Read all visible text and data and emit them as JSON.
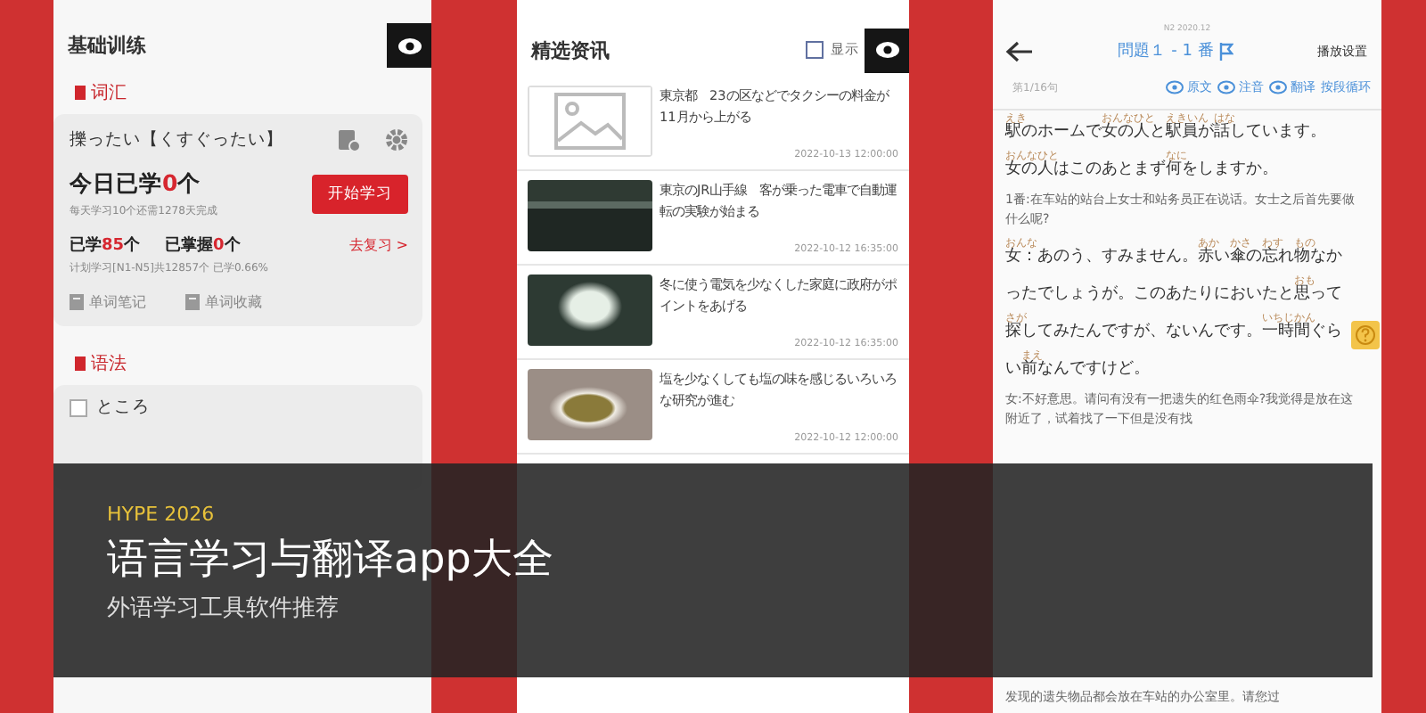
{
  "left_phone": {
    "title": "基础训练",
    "vocab": {
      "heading": "词汇",
      "word": "擽ったい【くすぐったい】",
      "today": {
        "label": "今日已学",
        "count": "0",
        "unit": "个"
      },
      "start_button": "开始学习",
      "daily_note": "每天学习10个还需1278天完成",
      "learned": {
        "label": "已学",
        "count": "85",
        "unit": "个"
      },
      "mastered": {
        "label": "已掌握",
        "count": "0",
        "unit": "个"
      },
      "review_link": "去复习 >",
      "plan_note": "计划学习[N1-N5]共12857个 已学0.66%",
      "links": [
        "单词笔记",
        "单词收藏"
      ]
    },
    "grammar": {
      "heading": "语法",
      "item": {
        "label": "ところ",
        "checked": false
      }
    }
  },
  "middle_phone": {
    "title": "精选资讯",
    "show_toggle": {
      "label": "显示",
      "checked": false
    },
    "articles": [
      {
        "kind": "placeholder",
        "title": "東京都　23の区などでタクシーの料金が11月から上がる",
        "date": "2022-10-13 12:00:00"
      },
      {
        "kind": "train",
        "title": "東京のJR山手線　客が乗った電車で自動運転の実験が始まる",
        "date": "2022-10-12 16:35:00"
      },
      {
        "kind": "lamp",
        "title": "冬に使う電気を少なくした家庭に政府がポイントをあげる",
        "date": "2022-10-12 16:35:00"
      },
      {
        "kind": "soup",
        "title": "塩を少なくしても塩の味を感じるいろいろな研究が進む",
        "date": "2022-10-12 12:00:00"
      }
    ]
  },
  "right_phone": {
    "exam": "N2 2020.12",
    "title": "問題１ - 1 番",
    "settings": "播放设置",
    "counter": "第1/16句",
    "toggles": [
      {
        "label": "原文"
      },
      {
        "label": "注音"
      },
      {
        "label": "翻译"
      }
    ],
    "loop": "按段循环",
    "blocks": [
      {
        "kind": "jp",
        "segments": [
          {
            "t": "駅",
            "r": "えき"
          },
          {
            "t": "のホームで"
          },
          {
            "t": "女",
            "r": "おんな"
          },
          {
            "t": "の"
          },
          {
            "t": "人",
            "r": "ひと"
          },
          {
            "t": "と"
          },
          {
            "t": "駅員",
            "r": "えきいん"
          },
          {
            "t": "が"
          },
          {
            "t": "話",
            "r": "はな"
          },
          {
            "t": "しています。"
          }
        ]
      },
      {
        "kind": "jp",
        "segments": [
          {
            "t": "女",
            "r": "おんな"
          },
          {
            "t": "の"
          },
          {
            "t": "人",
            "r": "ひと"
          },
          {
            "t": "はこのあとまず"
          },
          {
            "t": "何",
            "r": "なに"
          },
          {
            "t": "をしますか。"
          }
        ]
      },
      {
        "kind": "cn",
        "text": "1番:在车站的站台上女士和站务员正在说话。女士之后首先要做什么呢?"
      },
      {
        "kind": "jp",
        "segments": [
          {
            "t": "女",
            "r": "おんな"
          },
          {
            "t": "：あのう、すみません。"
          },
          {
            "t": "赤",
            "r": "あか"
          },
          {
            "t": "い"
          },
          {
            "t": "傘",
            "r": "かさ"
          },
          {
            "t": "の"
          },
          {
            "t": "忘",
            "r": "わす"
          },
          {
            "t": "れ"
          },
          {
            "t": "物",
            "r": "もの"
          },
          {
            "t": "なかったでしょうが。このあたりにおいたと"
          },
          {
            "t": "思",
            "r": "おも"
          },
          {
            "t": "って"
          },
          {
            "t": "探",
            "r": "さが"
          },
          {
            "t": "してみたんですが、ないんです。"
          },
          {
            "t": "一時間",
            "r": "いちじかん"
          },
          {
            "t": "ぐらい"
          },
          {
            "t": "前",
            "r": "まえ"
          },
          {
            "t": "なんですけど。"
          }
        ]
      },
      {
        "kind": "cn",
        "text": "女:不好意思。请问有没有一把遗失的红色雨伞?我觉得是放在这附近了，试着找了一下但是没有找"
      }
    ],
    "bottom_text": "发现的遗失物品都会放在车站的办公室里。请您过"
  },
  "banner": {
    "tag": "HYPE 2026",
    "title": "语言学习与翻译app大全",
    "subtitle": "外语学习工具软件推荐"
  }
}
